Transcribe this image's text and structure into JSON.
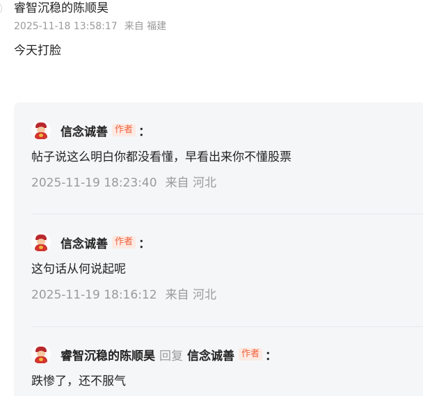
{
  "main_comment": {
    "author": "睿智沉稳的陈顺昊",
    "timestamp": "2025-11-18 13:58:17",
    "location": "来自 福建",
    "text": "今天打脸"
  },
  "badge_label": "作者",
  "colon": "：",
  "replies": [
    {
      "author": "信念诚善",
      "is_author": true,
      "text": "帖子说这么明白你都没看懂，早看出来你不懂股票",
      "timestamp": "2025-11-19 18:23:40",
      "location": "来自 河北"
    },
    {
      "author": "信念诚善",
      "is_author": true,
      "text": "这句话从何说起呢",
      "timestamp": "2025-11-19 18:16:12",
      "location": "来自 河北"
    },
    {
      "author": "睿智沉稳的陈顺昊",
      "reply_word": "回复",
      "reply_to": "信念诚善",
      "reply_to_is_author": true,
      "text": "跌惨了，还不服气"
    }
  ]
}
